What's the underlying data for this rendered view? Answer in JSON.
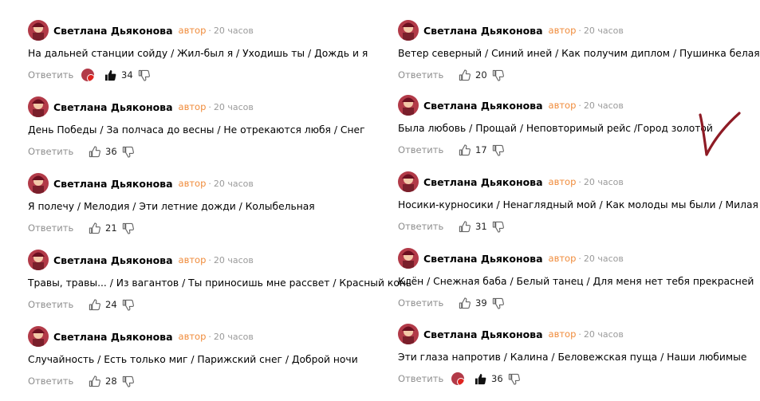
{
  "author_name": "Светлана Дьяконова",
  "author_tag": "автор",
  "separator": "·",
  "time_ago": "20 часов",
  "reply_label": "Ответить",
  "colors": {
    "author_tag": "#f08c3c",
    "muted": "#9a9a9a",
    "avatar": "#b23a48"
  },
  "left_comments": [
    {
      "text": "На дальней станции сойду / Жил-был я / Уходишь ты / Дождь и я",
      "likes": "34",
      "liked": true
    },
    {
      "text": "День Победы / За полчаса до весны / Не отрекаются любя / Снег",
      "likes": "36",
      "liked": false
    },
    {
      "text": "Я полечу / Мелодия / Эти летние дожди / Колыбельная",
      "likes": "21",
      "liked": false
    },
    {
      "text": "Травы, травы... / Из вагантов / Ты приносишь мне рассвет / Красный конь",
      "likes": "24",
      "liked": false
    },
    {
      "text": "Случайность / Есть только миг / Парижский снег / Доброй ночи",
      "likes": "28",
      "liked": false
    }
  ],
  "right_comments": [
    {
      "text": "Ветер северный / Синий иней / Как получим диплом / Пушинка белая",
      "likes": "20",
      "liked": false
    },
    {
      "text": "Была любовь / Прощай / Неповторимый рейс /Город золотой",
      "likes": "17",
      "liked": false
    },
    {
      "text": "Носики-курносики / Ненаглядный мой / Как молоды мы были / Милая моя",
      "likes": "31",
      "liked": false
    },
    {
      "text": "Клён / Снежная баба / Белый танец / Для меня нет тебя прекрасней",
      "likes": "39",
      "liked": false
    },
    {
      "text": "Эти глаза напротив / Калина / Беловежская пуща / Наши любимые",
      "likes": "36",
      "liked": true
    }
  ]
}
